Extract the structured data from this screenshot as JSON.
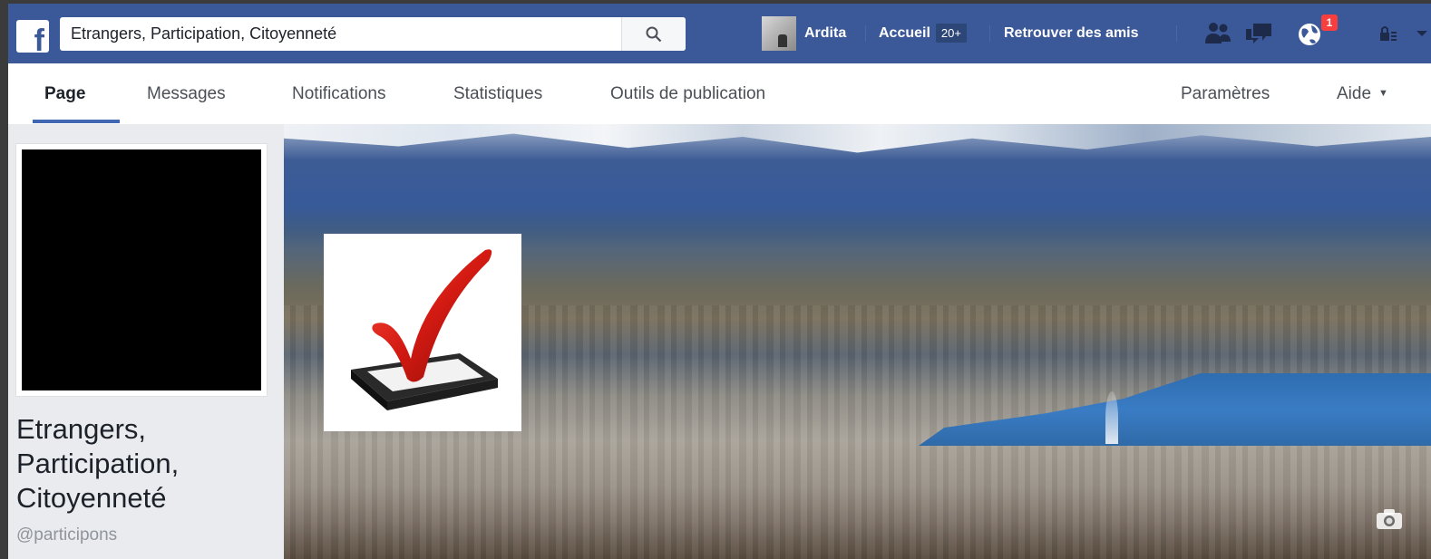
{
  "topbar": {
    "logo_letter": "f",
    "search_value": "Etrangers, Participation, Citoyenneté",
    "profile_name": "Ardita",
    "home_label": "Accueil",
    "home_count": "20+",
    "find_friends_label": "Retrouver des amis",
    "notifications_badge": "1",
    "icons": [
      "friend-requests-icon",
      "messages-icon",
      "notifications-globe-icon",
      "privacy-lock-icon",
      "account-menu-icon"
    ],
    "bar_color": "#3b5998"
  },
  "page_nav": {
    "tabs": [
      "Page",
      "Messages",
      "Notifications",
      "Statistiques",
      "Outils de publication"
    ],
    "active_tab": "Page",
    "settings_label": "Paramètres",
    "help_label": "Aide",
    "accent_color": "#4267b2"
  },
  "page_profile": {
    "name": "Etrangers, Participation, Citoyenneté",
    "handle": "@participons"
  },
  "cover": {
    "image_icons": [
      "checkmark-ballot-icon",
      "camera-icon"
    ]
  }
}
